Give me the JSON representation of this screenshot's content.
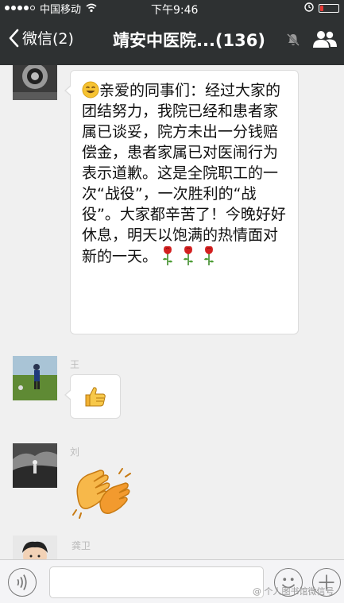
{
  "status_bar": {
    "carrier": "中国移动",
    "time": "下午9:46",
    "battery_level": 0.2
  },
  "nav": {
    "back_label": "微信(2)",
    "title": "靖安中医院...(136)"
  },
  "messages": [
    {
      "sender": "",
      "text": "亲爱的同事们：经过大家的团结努力，我院已经和患者家属已谈妥，院方未出一分钱赔偿金，患者家属已对医闹行为表示道歉。这是全院职工的一次“战役”，一次胜利的“战役”。大家都辛苦了！今晚好好休息，明天以饱满的热情面对新的一天。",
      "leading_emoji": "smile-emoji",
      "trailing_icons": [
        "rose-icon",
        "rose-icon",
        "rose-icon"
      ]
    },
    {
      "sender": "王",
      "emoji": "thumbs-up-emoji"
    },
    {
      "sender": "刘",
      "emoji": "clapping-hands-emoji"
    },
    {
      "sender": "龚卫",
      "emoji": ""
    }
  ],
  "input_bar": {
    "message_value": ""
  },
  "watermark": "@ 个人图书馆微信号"
}
